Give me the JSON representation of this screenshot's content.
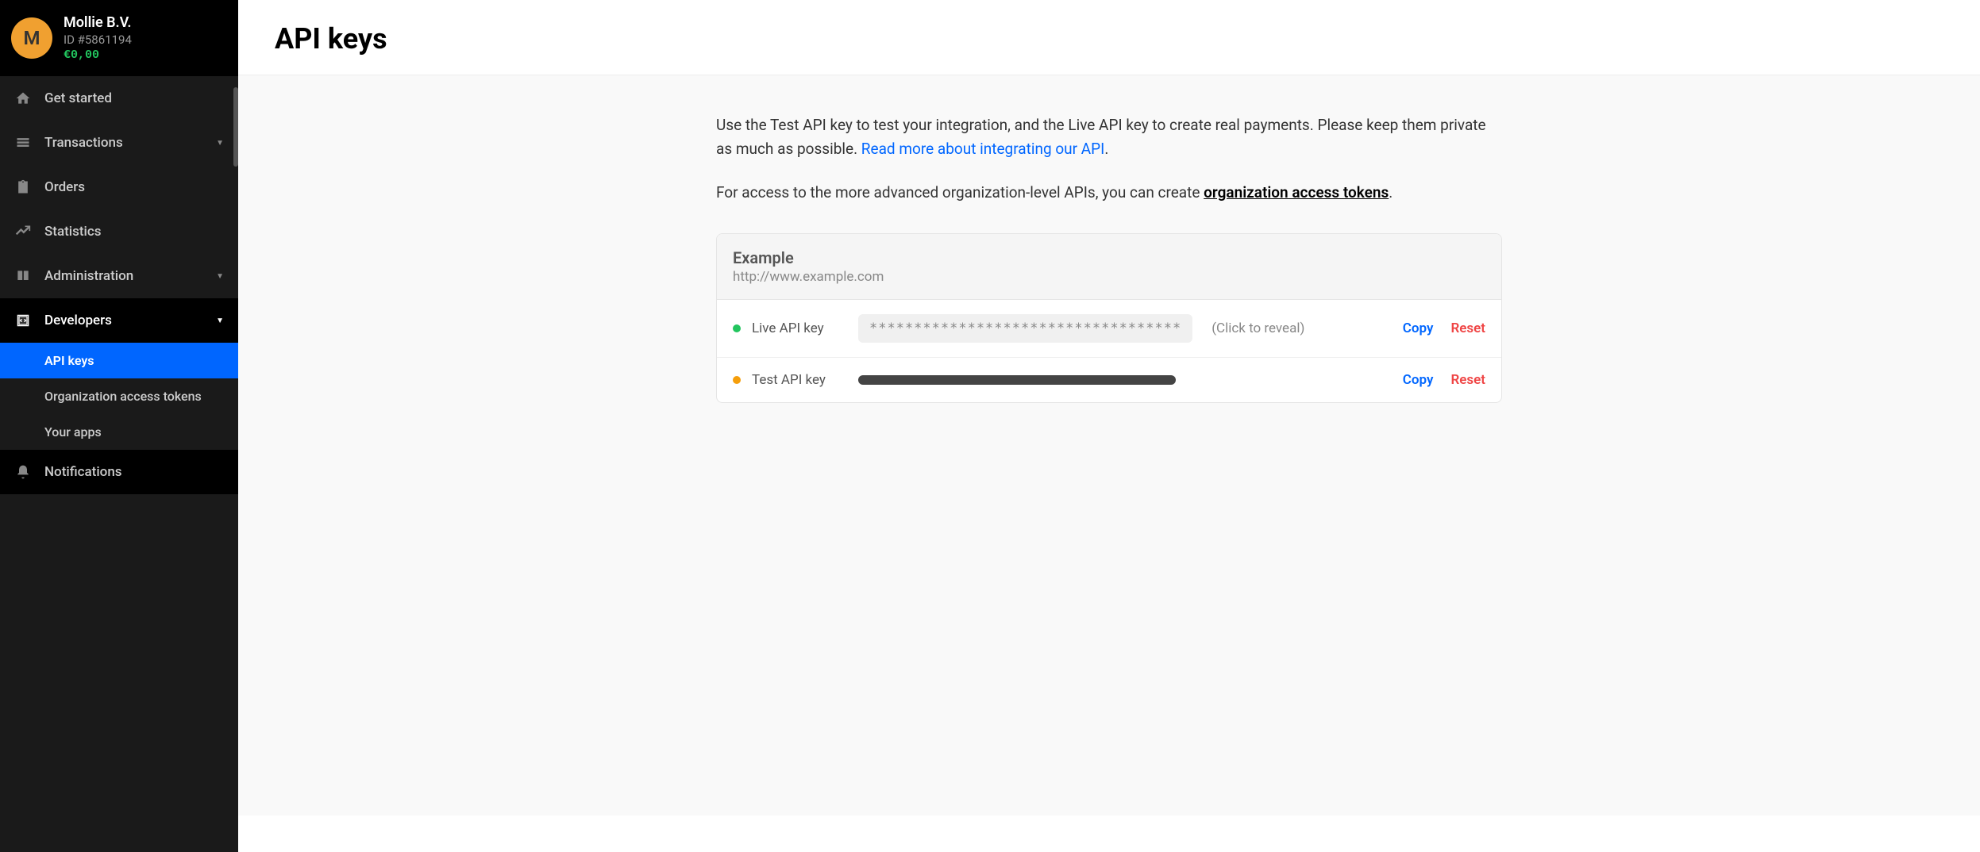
{
  "profile": {
    "initial": "M",
    "name": "Mollie B.V.",
    "id": "ID #5861194",
    "balance": "€0,00"
  },
  "nav": {
    "get_started": "Get started",
    "transactions": "Transactions",
    "orders": "Orders",
    "statistics": "Statistics",
    "administration": "Administration",
    "developers": "Developers",
    "notifications": "Notifications"
  },
  "subnav": {
    "api_keys": "API keys",
    "org_tokens": "Organization access tokens",
    "your_apps": "Your apps"
  },
  "page": {
    "title": "API keys",
    "intro_before_link": "Use the Test API key to test your integration, and the Live API key to create real payments. Please keep them private as much as possible. ",
    "read_more_link": "Read more about integrating our API",
    "intro_after_link": ".",
    "org_sentence_before": "For access to the more advanced organization-level APIs, you can create ",
    "org_link": "organization access tokens",
    "org_sentence_after": "."
  },
  "card": {
    "title": "Example",
    "url": "http://www.example.com",
    "live_label": "Live API key",
    "live_masked": "***********************************",
    "reveal_hint": "(Click to reveal)",
    "test_label": "Test API key",
    "copy": "Copy",
    "reset": "Reset"
  }
}
